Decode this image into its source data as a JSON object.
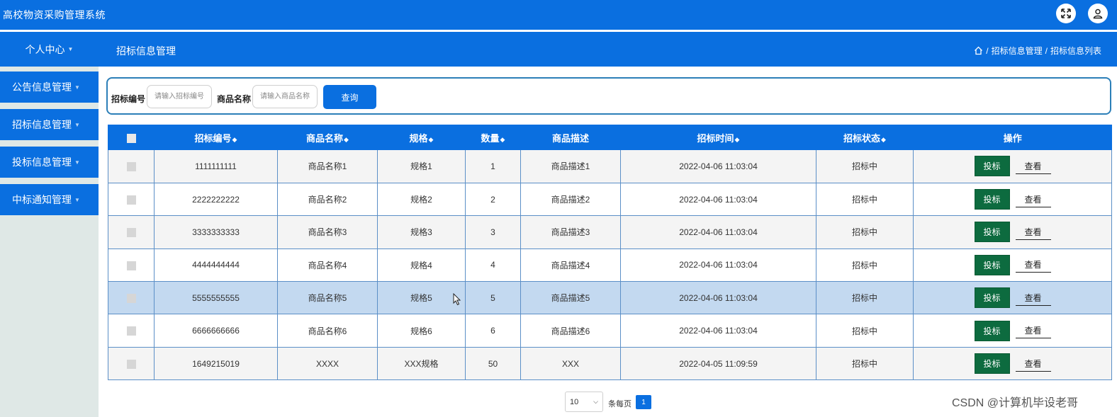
{
  "app": {
    "title": "高校物资采购管理系统"
  },
  "header": {
    "personal_center": "个人中心",
    "page_title": "招标信息管理",
    "breadcrumb": [
      "招标信息管理",
      "招标信息列表"
    ],
    "icons": [
      "expand-icon",
      "user-icon",
      "home-icon"
    ]
  },
  "sidebar": {
    "items": [
      {
        "label": "公告信息管理"
      },
      {
        "label": "招标信息管理"
      },
      {
        "label": "投标信息管理"
      },
      {
        "label": "中标通知管理"
      }
    ]
  },
  "search": {
    "field1_label": "招标编号",
    "field1_placeholder": "请输入招标编号",
    "field2_label": "商品名称",
    "field2_placeholder": "请输入商品名称",
    "button_label": "查询"
  },
  "table": {
    "columns": [
      "招标编号",
      "商品名称",
      "规格",
      "数量",
      "商品描述",
      "招标时间",
      "招标状态",
      "操作"
    ],
    "sortable": [
      true,
      true,
      true,
      true,
      false,
      true,
      true,
      false
    ],
    "rows": [
      {
        "code": "1111111111",
        "name": "商品名称1",
        "spec": "规格1",
        "qty": "1",
        "desc": "商品描述1",
        "time": "2022-04-06 11:03:04",
        "status": "招标中"
      },
      {
        "code": "2222222222",
        "name": "商品名称2",
        "spec": "规格2",
        "qty": "2",
        "desc": "商品描述2",
        "time": "2022-04-06 11:03:04",
        "status": "招标中"
      },
      {
        "code": "3333333333",
        "name": "商品名称3",
        "spec": "规格3",
        "qty": "3",
        "desc": "商品描述3",
        "time": "2022-04-06 11:03:04",
        "status": "招标中"
      },
      {
        "code": "4444444444",
        "name": "商品名称4",
        "spec": "规格4",
        "qty": "4",
        "desc": "商品描述4",
        "time": "2022-04-06 11:03:04",
        "status": "招标中"
      },
      {
        "code": "5555555555",
        "name": "商品名称5",
        "spec": "规格5",
        "qty": "5",
        "desc": "商品描述5",
        "time": "2022-04-06 11:03:04",
        "status": "招标中"
      },
      {
        "code": "6666666666",
        "name": "商品名称6",
        "spec": "规格6",
        "qty": "6",
        "desc": "商品描述6",
        "time": "2022-04-06 11:03:04",
        "status": "招标中"
      },
      {
        "code": "1649215019",
        "name": "XXXX",
        "spec": "XXX规格",
        "qty": "50",
        "desc": "XXX",
        "time": "2022-04-05 11:09:59",
        "status": "招标中"
      }
    ],
    "bid_label": "投标",
    "view_label": "查看"
  },
  "pagination": {
    "page_size": "10",
    "per_page_label": "条每页",
    "current_page": "1"
  },
  "watermark": "CSDN @计算机毕设老哥",
  "colors": {
    "primary": "#0a6fe0",
    "bid_button": "#0d6b3f",
    "row_hover": "#c3d9f0",
    "sidebar_bg": "#dfe8e6"
  }
}
